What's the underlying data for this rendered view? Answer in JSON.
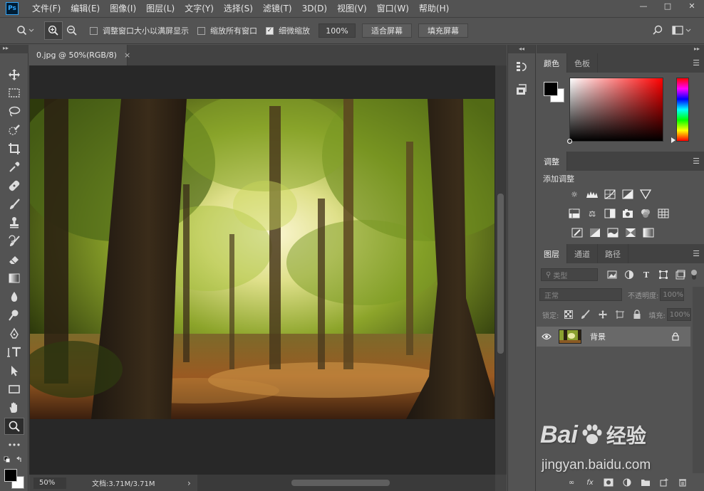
{
  "app": {
    "logo": "Ps"
  },
  "menu": [
    "文件(F)",
    "编辑(E)",
    "图像(I)",
    "图层(L)",
    "文字(Y)",
    "选择(S)",
    "滤镜(T)",
    "3D(D)",
    "视图(V)",
    "窗口(W)",
    "帮助(H)"
  ],
  "window_controls": {
    "minimize": "—",
    "maximize": "□",
    "close": "✕"
  },
  "options": {
    "resize_windows": {
      "label": "调整窗口大小以满屏显示",
      "checked": false
    },
    "zoom_all": {
      "label": "缩放所有窗口",
      "checked": false
    },
    "scrubby_zoom": {
      "label": "细微缩放",
      "checked": true
    },
    "zoom_value": "100%",
    "fit_screen": "适合屏幕",
    "fill_screen": "填充屏幕"
  },
  "document": {
    "tab_title": "0.jpg @ 50%(RGB/8)",
    "close_glyph": "×"
  },
  "status": {
    "zoom": "50%",
    "doc_info": "文档:3.71M/3.71M",
    "arrow": "›"
  },
  "panels": {
    "color_tabs": [
      "颜色",
      "色板"
    ],
    "adjust_tab": "调整",
    "adjust_title": "添加调整",
    "layers_tabs": [
      "图层",
      "通道",
      "路径"
    ],
    "filter_kind": "类型",
    "blend_mode": "正常",
    "opacity_label": "不透明度:",
    "opacity_value": "100%",
    "lock_label": "锁定:",
    "fill_label": "填充:",
    "fill_value": "100%",
    "layer_name": "背景"
  },
  "watermark": {
    "brand_left": "Bai",
    "brand_right": "经验",
    "url": "jingyan.baidu.com"
  },
  "colors": {
    "foreground": "#000000",
    "background": "#ffffff"
  }
}
